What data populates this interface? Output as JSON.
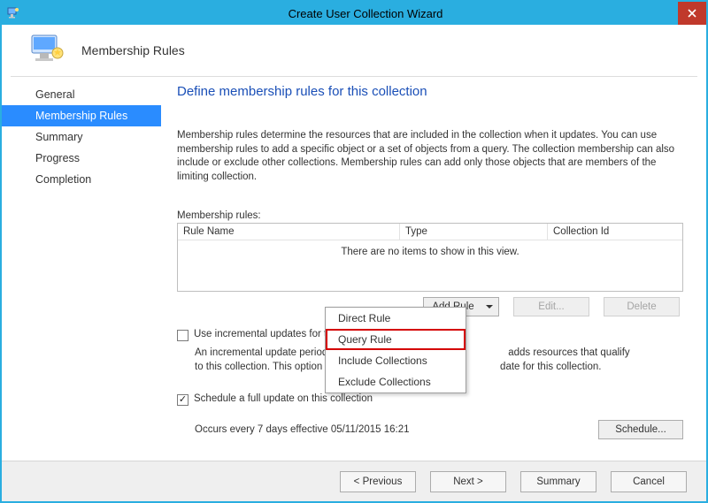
{
  "window": {
    "title": "Create User Collection Wizard"
  },
  "header": {
    "label": "Membership Rules"
  },
  "sidebar": {
    "items": [
      {
        "label": "General"
      },
      {
        "label": "Membership Rules"
      },
      {
        "label": "Summary"
      },
      {
        "label": "Progress"
      },
      {
        "label": "Completion"
      }
    ],
    "selectedIndex": 1
  },
  "page": {
    "title": "Define membership rules for this collection",
    "description": "Membership rules determine the resources that are included in the collection when it updates. You can use membership rules to add a specific object or a set of objects from a query. The collection membership can also include or exclude other collections. Membership rules can add only those objects that are members of the limiting collection.",
    "rules_label": "Membership rules:",
    "columns": {
      "name": "Rule Name",
      "type": "Type",
      "id": "Collection Id"
    },
    "empty": "There are no items to show in this view.",
    "buttons": {
      "add": "Add Rule",
      "edit": "Edit...",
      "delete": "Delete",
      "schedule": "Schedule..."
    },
    "incremental_label": "Use incremental updates for this collection",
    "incremental_desc_a": "An incremental update periodically",
    "incremental_desc_b": "adds resources that qualify",
    "incremental_desc_c": "to this collection. This option doe",
    "incremental_desc_d": "date for this collection.",
    "full_update_label": "Schedule a full update on this collection",
    "schedule_text": "Occurs every 7 days effective 05/11/2015 16:21"
  },
  "menu": {
    "items": [
      {
        "label": "Direct Rule"
      },
      {
        "label": "Query Rule"
      },
      {
        "label": "Include Collections"
      },
      {
        "label": "Exclude Collections"
      }
    ],
    "highlightIndex": 1
  },
  "footer": {
    "previous": "< Previous",
    "next": "Next >",
    "summary": "Summary",
    "cancel": "Cancel"
  }
}
